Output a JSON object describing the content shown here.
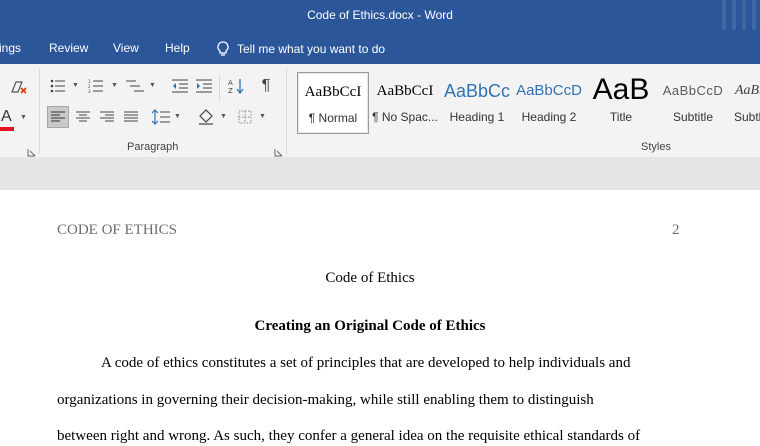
{
  "window": {
    "title": "Code of Ethics.docx  -  Word"
  },
  "menu": {
    "tabs": [
      "ings",
      "Review",
      "View",
      "Help"
    ],
    "tell_me": "Tell me what you want to do"
  },
  "ribbon": {
    "groups": {
      "paragraph": "Paragraph",
      "styles": "Styles"
    },
    "styles": [
      {
        "preview": "AaBbCcI",
        "name": "¶ Normal",
        "selected": true
      },
      {
        "preview": "AaBbCcI",
        "name": "¶ No Spac..."
      },
      {
        "preview": "AaBbCc",
        "name": "Heading 1"
      },
      {
        "preview": "AaBbCcD",
        "name": "Heading 2"
      },
      {
        "preview": "AaB",
        "name": "Title"
      },
      {
        "preview": "AaBbCcD",
        "name": "Subtitle"
      },
      {
        "preview": "AaBb",
        "name": "Subtl"
      }
    ],
    "font_color_letter": "A",
    "colors": {
      "accent": "#2b579a",
      "font_color_bar": "#e81123",
      "heading_blue": "#2e74b5"
    }
  },
  "document": {
    "header_left": "CODE OF ETHICS",
    "header_page": "2",
    "title": "Code of Ethics",
    "heading": "Creating an Original Code of Ethics",
    "body_lines": [
      "A code of ethics constitutes a set of principles that are developed to help individuals and",
      "organizations in governing their decision-making, while still enabling them to distinguish",
      "between right and wrong. As such, they confer a general idea on the requisite ethical standards of"
    ]
  }
}
